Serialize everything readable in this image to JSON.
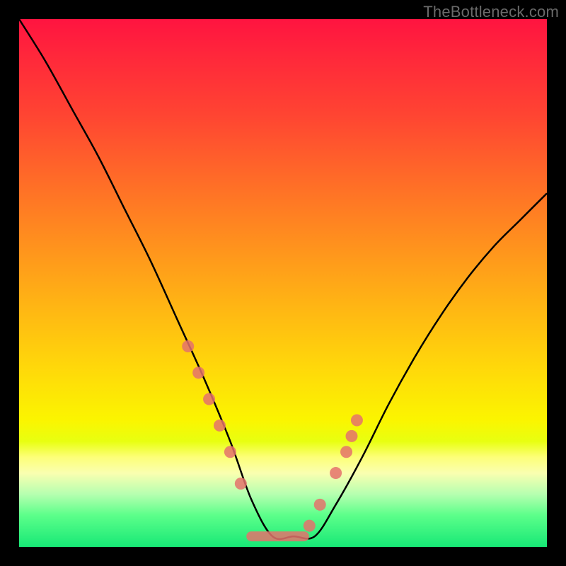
{
  "watermark": "TheBottleneck.com",
  "colors": {
    "frame": "#000000",
    "curve": "#000000",
    "marker": "#e4726c"
  },
  "chart_data": {
    "type": "line",
    "title": "",
    "xlabel": "",
    "ylabel": "",
    "xlim": [
      0,
      100
    ],
    "ylim": [
      0,
      100
    ],
    "grid": false,
    "note": "No axis tick labels are rendered in the image; x/y units are relative percentages of the plot area. y=0 is the bottom green band, y=100 is the top red band.",
    "series": [
      {
        "name": "bottleneck-curve",
        "x": [
          0,
          5,
          10,
          15,
          20,
          25,
          30,
          35,
          40,
          44,
          48,
          52,
          56,
          60,
          65,
          70,
          75,
          80,
          85,
          90,
          95,
          100
        ],
        "y": [
          100,
          92,
          83,
          74,
          64,
          54,
          43,
          32,
          20,
          9,
          2,
          2,
          2,
          8,
          17,
          27,
          36,
          44,
          51,
          57,
          62,
          67
        ]
      }
    ],
    "markers": {
      "name": "highlighted-points",
      "note": "Coral dots along the curve near the valley; a flat coral segment marks the minimum plateau.",
      "x": [
        32,
        34,
        36,
        38,
        40,
        42,
        55,
        57,
        60,
        62,
        63,
        64
      ],
      "y": [
        38,
        33,
        28,
        23,
        18,
        12,
        4,
        8,
        14,
        18,
        21,
        24
      ]
    },
    "plateau": {
      "x_start": 44,
      "x_end": 54,
      "y": 2
    }
  }
}
